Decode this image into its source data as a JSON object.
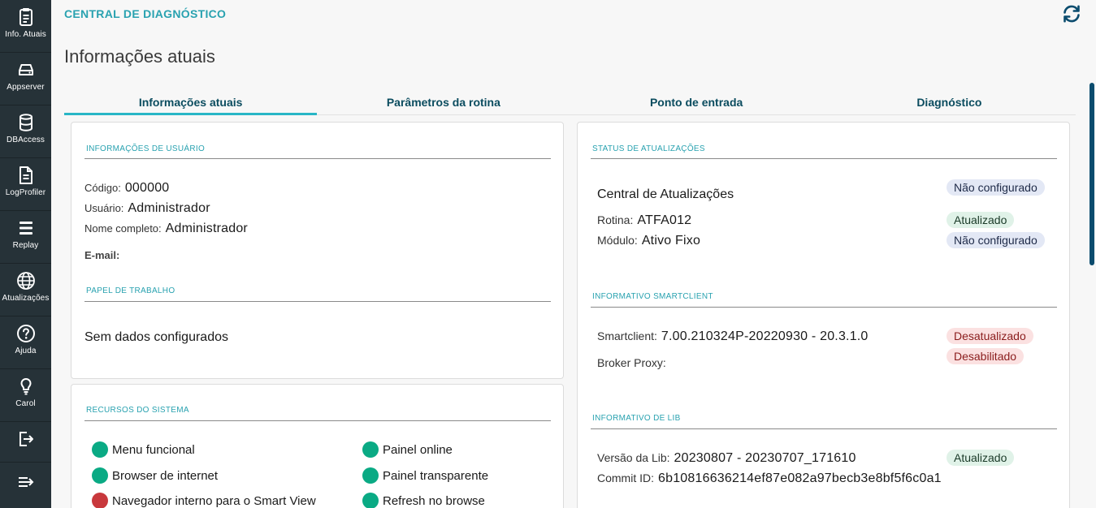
{
  "sidebar": {
    "items": [
      {
        "label": "Info. Atuais",
        "icon": "clipboard-icon"
      },
      {
        "label": "Appserver",
        "icon": "server-icon"
      },
      {
        "label": "DBAccess",
        "icon": "database-icon"
      },
      {
        "label": "LogProfiler",
        "icon": "file-text-icon"
      },
      {
        "label": "Replay",
        "icon": "replay-icon"
      },
      {
        "label": "Atualizações",
        "icon": "globe-icon"
      },
      {
        "label": "Ajuda",
        "icon": "help-icon"
      },
      {
        "label": "Carol",
        "icon": "lightbulb-icon"
      },
      {
        "label": "",
        "icon": "logout-icon"
      },
      {
        "label": "",
        "icon": "collapse-menu-icon"
      }
    ]
  },
  "header": {
    "app_title": "CENTRAL DE DIAGNÓSTICO",
    "page_title": "Informações atuais"
  },
  "tabs": [
    {
      "label": "Informações atuais",
      "active": true
    },
    {
      "label": "Parâmetros da rotina",
      "active": false
    },
    {
      "label": "Ponto de entrada",
      "active": false
    },
    {
      "label": "Diagnóstico",
      "active": false
    }
  ],
  "user_info": {
    "title": "INFORMAÇÕES DE USUÁRIO",
    "codigo_label": "Código:",
    "codigo_value": "000000",
    "usuario_label": "Usuário:",
    "usuario_value": "Administrador",
    "nome_label": "Nome completo:",
    "nome_value": "Administrador",
    "email_label": "E-mail:",
    "email_value": ""
  },
  "work_paper": {
    "title": "PAPEL DE TRABALHO",
    "empty_text": "Sem dados configurados"
  },
  "system_resources": {
    "title": "RECURSOS DO SISTEMA",
    "items": [
      {
        "label": "Menu funcional",
        "status": "ok"
      },
      {
        "label": "Painel online",
        "status": "ok"
      },
      {
        "label": "Browser de internet",
        "status": "ok"
      },
      {
        "label": "Painel transparente",
        "status": "ok"
      },
      {
        "label": "Navegador interno para o Smart View",
        "status": "bad"
      },
      {
        "label": "Refresh no browse",
        "status": "ok"
      }
    ]
  },
  "update_status": {
    "title": "STATUS DE ATUALIZAÇÕES",
    "central_label": "Central de Atualizações",
    "central_badge": "Não configurado",
    "rotina_label": "Rotina:",
    "rotina_value": "ATFA012",
    "rotina_badge": "Atualizado",
    "modulo_label": "Módulo:",
    "modulo_value": "Ativo Fixo",
    "modulo_badge": "Não configurado"
  },
  "smartclient": {
    "title": "INFORMATIVO SMARTCLIENT",
    "smartclient_label": "Smartclient:",
    "smartclient_value": "7.00.210324P-20220930 - 20.3.1.0",
    "smartclient_badge": "Desatualizado",
    "broker_label": "Broker Proxy:",
    "broker_value": "",
    "broker_badge": "Desabilitado"
  },
  "lib": {
    "title": "INFORMATIVO DE LIB",
    "versao_label": "Versão da Lib:",
    "versao_value": "20230807 - 20230707_171610",
    "versao_badge": "Atualizado",
    "commit_label": "Commit ID:",
    "commit_value": "6b10816636214ef87e082a97becb3e8bf5f6c0a1"
  },
  "colors": {
    "sidebar_bg": "#263238",
    "accent": "#29a2b0",
    "tab_text": "#0b4c5f",
    "ok": "#0aaa84",
    "error": "#c8383c"
  }
}
